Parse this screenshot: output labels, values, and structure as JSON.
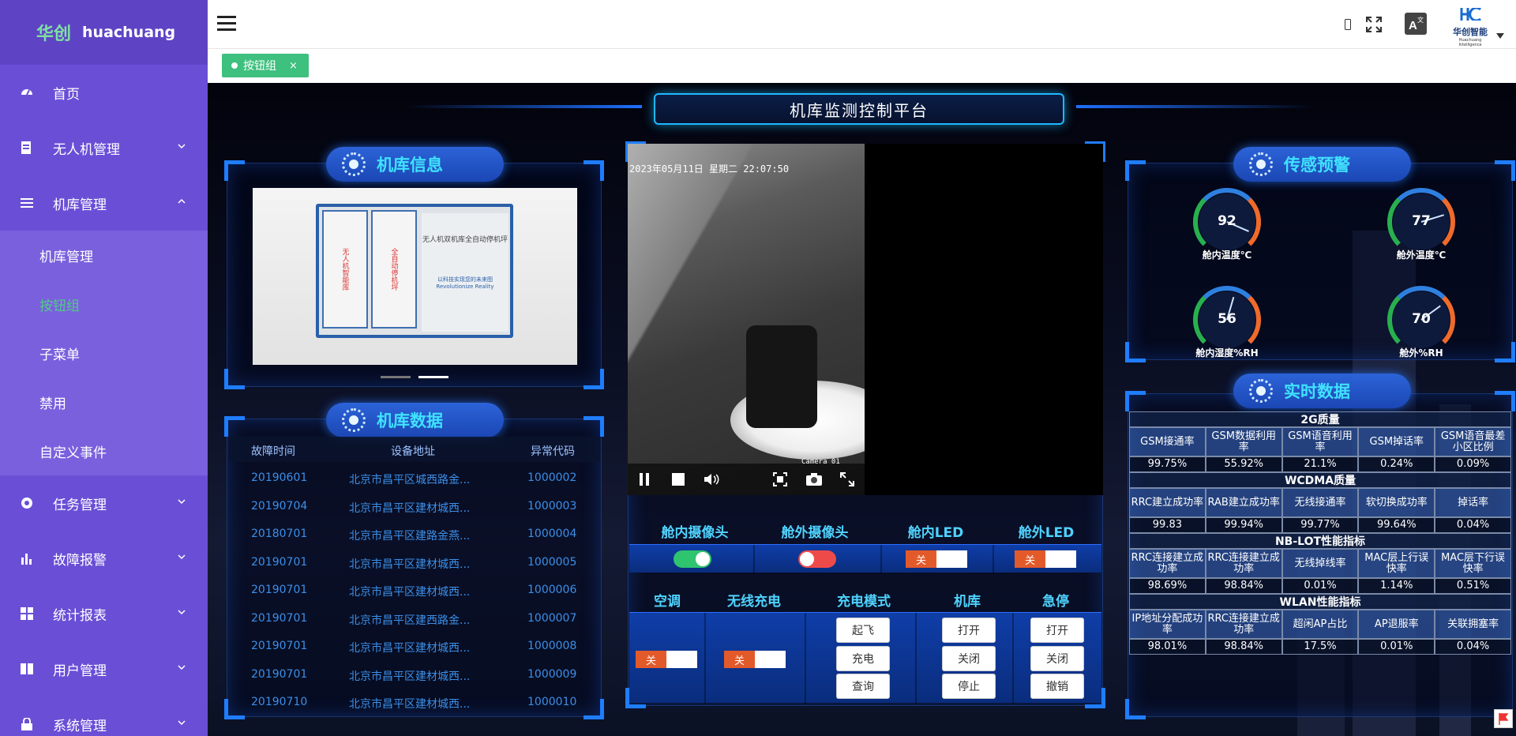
{
  "sidebar": {
    "logo_cn": "华创",
    "logo_en": "huachuang",
    "items": [
      {
        "label": "首页"
      },
      {
        "label": "无人机管理"
      },
      {
        "label": "机库管理"
      },
      {
        "label": "任务管理"
      },
      {
        "label": "故障报警"
      },
      {
        "label": "统计报表"
      },
      {
        "label": "用户管理"
      },
      {
        "label": "系统管理"
      }
    ],
    "submenu": [
      {
        "label": "机库管理"
      },
      {
        "label": "按钮组"
      },
      {
        "label": "子菜单"
      },
      {
        "label": "禁用"
      },
      {
        "label": "自定义事件"
      }
    ]
  },
  "topbar": {
    "brand_name": "华创智能",
    "brand_sub": "Huachuang Intelligence"
  },
  "tabs": {
    "active_label": "按钮组",
    "close": "×"
  },
  "dashboard": {
    "title": "机库监测控制平台",
    "info_title": "机库信息",
    "data_title": "机库数据",
    "sensor_title": "传感预警",
    "realtime_title": "实时数据",
    "kiosk_door_left": "无人机智能库",
    "kiosk_door_right": "全自动停机坪",
    "kiosk_side": "无人机双机库全自动停机坪",
    "kiosk_side_small": "以科技实现您的未来图 Revolutionize Reality",
    "video_timestamp": "2023年05月11日 星期二 22:07:50",
    "video_cam": "Camera 01",
    "table": {
      "headers": [
        "故障时间",
        "设备地址",
        "异常代码"
      ],
      "rows": [
        [
          "20190601",
          "北京市昌平区城西路金...",
          "1000002"
        ],
        [
          "20190704",
          "北京市昌平区建材城西...",
          "1000003"
        ],
        [
          "20180701",
          "北京市昌平区建路金燕...",
          "1000004"
        ],
        [
          "20190701",
          "北京市昌平区建材城西...",
          "1000005"
        ],
        [
          "20190701",
          "北京市昌平区建材城西...",
          "1000006"
        ],
        [
          "20190701",
          "北京市昌平区建西路金...",
          "1000007"
        ],
        [
          "20190701",
          "北京市昌平区建材城西...",
          "1000008"
        ],
        [
          "20190701",
          "北京市昌平区建材城西...",
          "1000009"
        ],
        [
          "20190710",
          "北京市昌平区建材城西...",
          "1000010"
        ]
      ]
    },
    "controls_row1": [
      "舱内摄像头",
      "舱外摄像头",
      "舱内LED",
      "舱外LED"
    ],
    "controls_row2": [
      "空调",
      "无线充电",
      "充电模式",
      "机库",
      "急停"
    ],
    "off_label": "关",
    "charge_buttons": [
      "起飞",
      "充电",
      "查询"
    ],
    "hangar_buttons": [
      "打开",
      "关闭",
      "停止"
    ],
    "estop_buttons": [
      "打开",
      "关闭",
      "撤销"
    ],
    "gauges": [
      {
        "value": "92",
        "label": "舱内温度℃",
        "level": 0.92
      },
      {
        "value": "77",
        "label": "舱外温度℃",
        "level": 0.77
      },
      {
        "value": "56",
        "label": "舱内湿度%RH",
        "level": 0.56
      },
      {
        "value": "70",
        "label": "舱外%RH",
        "level": 0.7
      }
    ],
    "realtime": [
      {
        "section": "2G质量",
        "headers": [
          "GSM接通率",
          "GSM数据利用率",
          "GSM语音利用率",
          "GSM掉话率",
          "GSM语音最差小区比例"
        ],
        "values": [
          "99.75%",
          "55.92%",
          "21.1%",
          "0.24%",
          "0.09%"
        ]
      },
      {
        "section": "WCDMA质量",
        "headers": [
          "RRC建立成功率",
          "RAB建立成功率",
          "无线接通率",
          "软切换成功率",
          "掉话率"
        ],
        "values": [
          "99.83",
          "99.94%",
          "99.77%",
          "99.64%",
          "0.04%"
        ]
      },
      {
        "section": "NB-LOT性能指标",
        "headers": [
          "RRC连接建立成功率",
          "RRC连接建立成功率",
          "无线掉线率",
          "MAC层上行误快率",
          "MAC层下行误快率"
        ],
        "values": [
          "98.69%",
          "98.84%",
          "0.01%",
          "1.14%",
          "0.51%"
        ]
      },
      {
        "section": "WLAN性能指标",
        "headers": [
          "IP地址分配成功率",
          "RRC连接建立成功率",
          "超闲AP占比",
          "AP退服率",
          "关联拥塞率"
        ],
        "values": [
          "98.01%",
          "98.84%",
          "17.5%",
          "0.01%",
          "0.04%"
        ]
      }
    ]
  },
  "colors": {
    "sidebar": "#6a4fd6",
    "accent_green": "#3ec07e",
    "panel_blue": "#1f7dff",
    "title_cyan": "#3fe2ff"
  }
}
